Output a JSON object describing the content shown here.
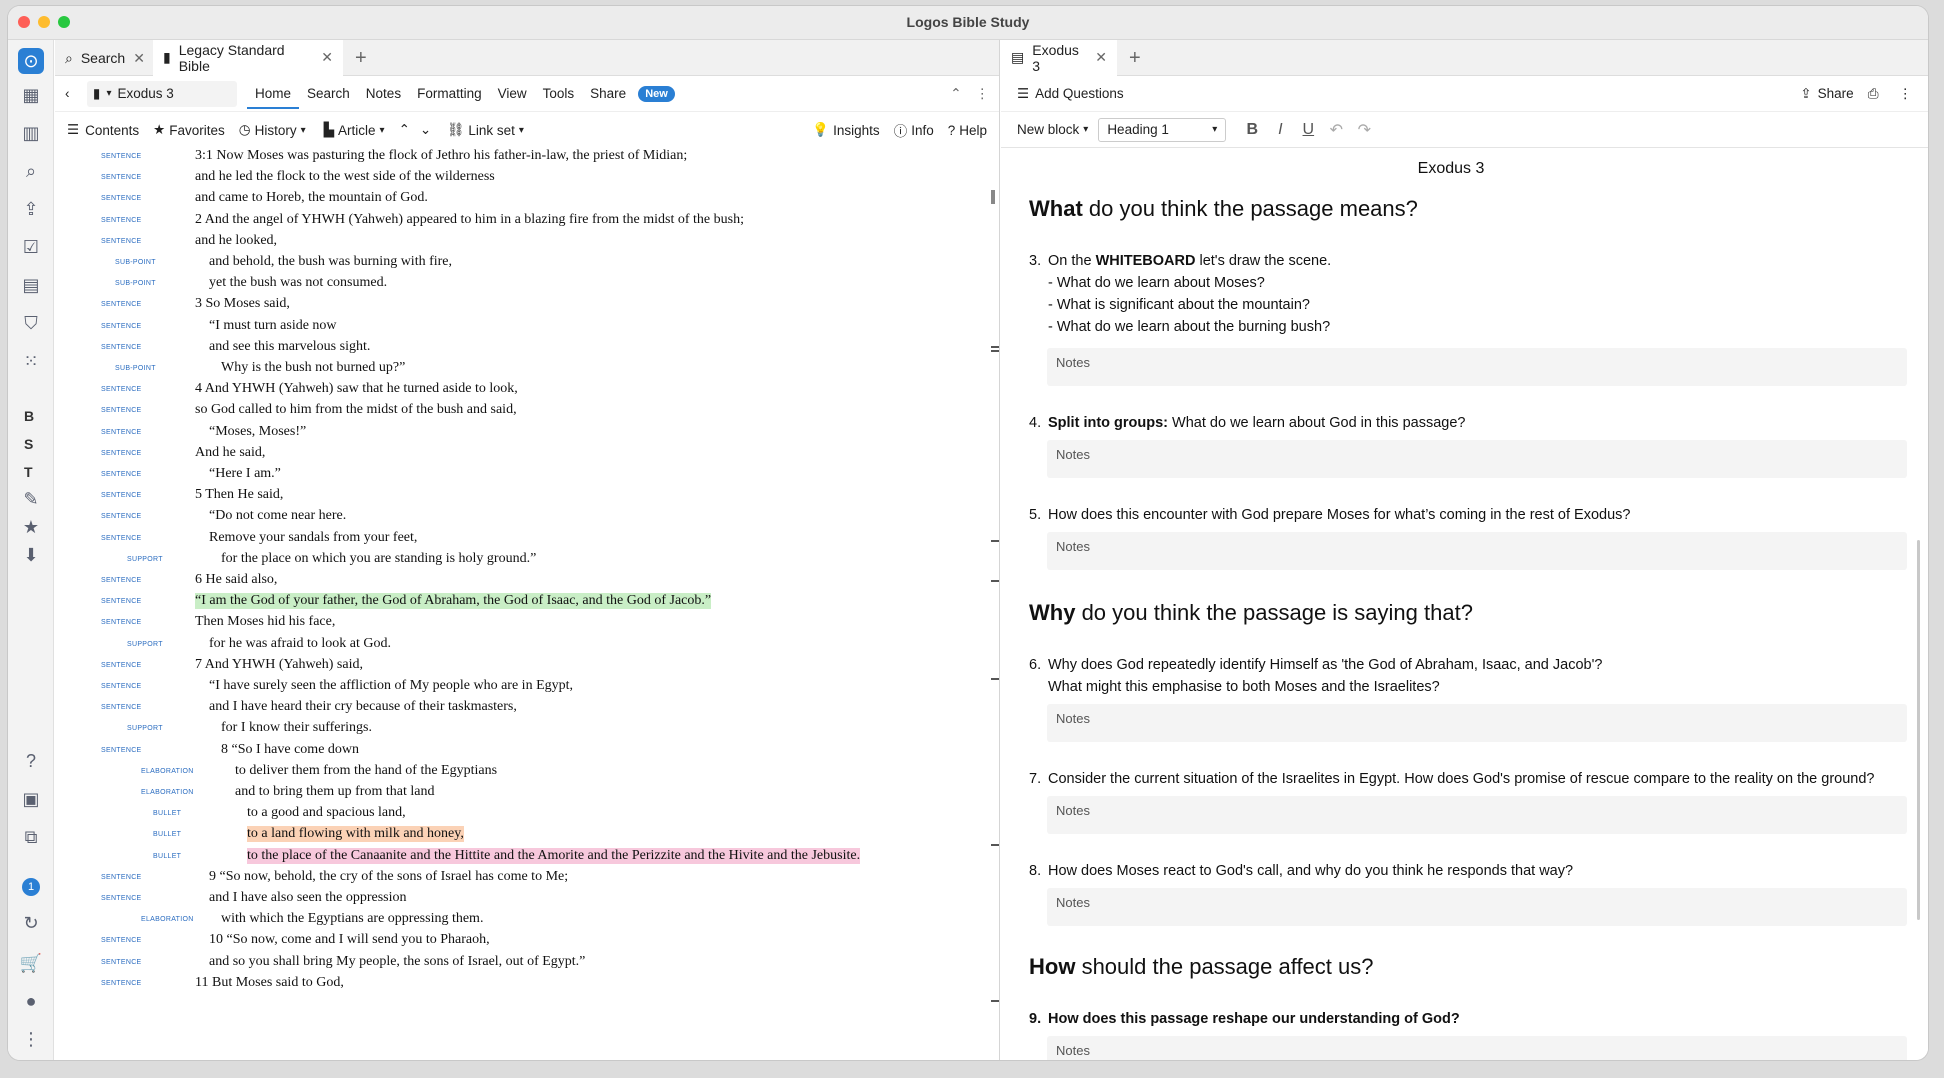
{
  "app_title": "Logos Bible Study",
  "sidebar": {
    "letters": [
      "B",
      "S",
      "T"
    ],
    "badge": "1"
  },
  "left_tabs": [
    {
      "label": "Search"
    },
    {
      "label": "Legacy Standard Bible"
    }
  ],
  "left_toolbar": {
    "reference": "Exodus 3",
    "menu": [
      "Home",
      "Search",
      "Notes",
      "Formatting",
      "View",
      "Tools",
      "Share"
    ],
    "new_badge": "New"
  },
  "left_subbar": {
    "contents": "Contents",
    "favorites": "Favorites",
    "history": "History",
    "article": "Article",
    "linkset": "Link set",
    "insights": "Insights",
    "info": "Info",
    "help": "Help"
  },
  "bible_lines": [
    {
      "label": "Sentence",
      "indent": 0,
      "text": "3:1 Now Moses was pasturing the flock of Jethro his father-in-law, the priest of Midian;"
    },
    {
      "label": "Sentence",
      "indent": 0,
      "text": "and he led the flock to the west side of the wilderness"
    },
    {
      "label": "Sentence",
      "indent": 0,
      "text": "and came to Horeb, the mountain of God."
    },
    {
      "label": "Sentence",
      "indent": 0,
      "text": "2 And the angel of YHWH (Yahweh) appeared to him in a blazing fire from the midst of the bush;"
    },
    {
      "label": "Sentence",
      "indent": 0,
      "text": "and he looked,"
    },
    {
      "label": "Sub-point",
      "indent": 1,
      "text": "and behold, the bush was burning with fire,"
    },
    {
      "label": "Sub-point",
      "indent": 1,
      "text": "yet the bush was not consumed."
    },
    {
      "label": "Sentence",
      "indent": 0,
      "text": "3 So Moses said,"
    },
    {
      "label": "Sentence",
      "indent": 1,
      "text": "“I must turn aside now"
    },
    {
      "label": "Sentence",
      "indent": 1,
      "text": "and see this marvelous sight."
    },
    {
      "label": "Sub-point",
      "indent": 2,
      "text": "Why is the bush not burned up?”"
    },
    {
      "label": "Sentence",
      "indent": 0,
      "text": "4 And YHWH (Yahweh) saw that he turned aside to look,"
    },
    {
      "label": "Sentence",
      "indent": 0,
      "text": "so God called to him from the midst of the bush and said,"
    },
    {
      "label": "Sentence",
      "indent": 1,
      "text": "“Moses, Moses!”"
    },
    {
      "label": "Sentence",
      "indent": 0,
      "text": "And he said,"
    },
    {
      "label": "Sentence",
      "indent": 1,
      "text": "“Here I am.”"
    },
    {
      "label": "Sentence",
      "indent": 0,
      "text": "5 Then He said,"
    },
    {
      "label": "Sentence",
      "indent": 1,
      "text": "“Do not come near here."
    },
    {
      "label": "Sentence",
      "indent": 1,
      "text": "Remove your sandals from your feet,"
    },
    {
      "label": "Support",
      "indent": 2,
      "text": "for the place on which you are standing is holy ground.”"
    },
    {
      "label": "Sentence",
      "indent": 0,
      "text": "6 He said also,"
    },
    {
      "label": "Sentence",
      "indent": 0,
      "text": "“I am the God of your father, the God of Abraham, the God of Isaac, and the God of Jacob.”",
      "hl": "green"
    },
    {
      "label": "Sentence",
      "indent": 0,
      "text": "Then Moses hid his face,"
    },
    {
      "label": "Support",
      "indent": 1,
      "text": "for he was afraid to look at God."
    },
    {
      "label": "Sentence",
      "indent": 0,
      "text": "7 And YHWH (Yahweh) said,"
    },
    {
      "label": "Sentence",
      "indent": 1,
      "text": "“I have surely seen the affliction of My people who are in Egypt,"
    },
    {
      "label": "Sentence",
      "indent": 1,
      "text": "and I have heard their cry because of their taskmasters,"
    },
    {
      "label": "Support",
      "indent": 2,
      "text": "for I know their sufferings."
    },
    {
      "label": "Sentence",
      "indent": 2,
      "text": "8 “So I have come down"
    },
    {
      "label": "Elaboration",
      "indent": 3,
      "text": "to deliver them from the hand of the Egyptians"
    },
    {
      "label": "Elaboration",
      "indent": 3,
      "text": "and to bring them up from that land"
    },
    {
      "label": "Bullet",
      "indent": 4,
      "text": "to a good and spacious land,"
    },
    {
      "label": "Bullet",
      "indent": 4,
      "text": "to a land flowing with milk and honey,",
      "hl": "orange"
    },
    {
      "label": "Bullet",
      "indent": 4,
      "text": "to the place of the Canaanite and the Hittite and the Amorite and the Perizzite and the Hivite and the Jebusite.",
      "hl": "pink"
    },
    {
      "label": "Sentence",
      "indent": 1,
      "text": "9 “So now, behold, the cry of the sons of Israel has come to Me;"
    },
    {
      "label": "Sentence",
      "indent": 1,
      "text": "and I have also seen the oppression"
    },
    {
      "label": "Elaboration",
      "indent": 2,
      "text": "with which the Egyptians are oppressing them."
    },
    {
      "label": "Sentence",
      "indent": 1,
      "text": "10 “So now, come and I will send you to Pharaoh,"
    },
    {
      "label": "Sentence",
      "indent": 1,
      "text": "and so you shall bring My people, the sons of Israel, out of Egypt.”"
    },
    {
      "label": "Sentence",
      "indent": 0,
      "text": "11 But Moses said to God,"
    }
  ],
  "right_tab": {
    "label": "Exodus 3"
  },
  "right_toolbar": {
    "add_questions": "Add Questions",
    "share": "Share"
  },
  "right_format": {
    "block": "New block",
    "style": "Heading 1"
  },
  "doc": {
    "title": "Exodus 3",
    "sections": [
      {
        "strong": "What",
        "rest": " do you think the passage means?"
      },
      {
        "strong": "Why",
        "rest": " do you think the passage is saying that?"
      },
      {
        "strong": "How",
        "rest": " should the passage affect us?"
      }
    ],
    "questions": [
      {
        "num": "3.",
        "lines": [
          "On the WHITEBOARD let's draw the scene.",
          "- What do we learn about Moses?",
          "- What is significant about the mountain?",
          "- What do we learn about the burning bush?"
        ]
      },
      {
        "num": "4.",
        "lines": [
          "Split into groups: What do we learn about God in this passage?"
        ]
      },
      {
        "num": "5.",
        "lines": [
          "How does this encounter with God prepare Moses for what’s coming in the rest of Exodus?"
        ]
      },
      {
        "num": "6.",
        "lines": [
          "Why does God repeatedly identify Himself as 'the God of Abraham, Isaac, and Jacob'?",
          "What might this emphasise to both Moses and the Israelites?"
        ]
      },
      {
        "num": "7.",
        "lines": [
          "Consider the current situation of the Israelites in Egypt. How does God's promise of rescue compare to the reality on the ground?"
        ]
      },
      {
        "num": "8.",
        "lines": [
          "How does Moses react to God's call, and why do you think he responds that way?"
        ]
      },
      {
        "num": "9.",
        "lines": [
          "How does this passage reshape our understanding of God?"
        ]
      }
    ],
    "notes_label": "Notes"
  }
}
